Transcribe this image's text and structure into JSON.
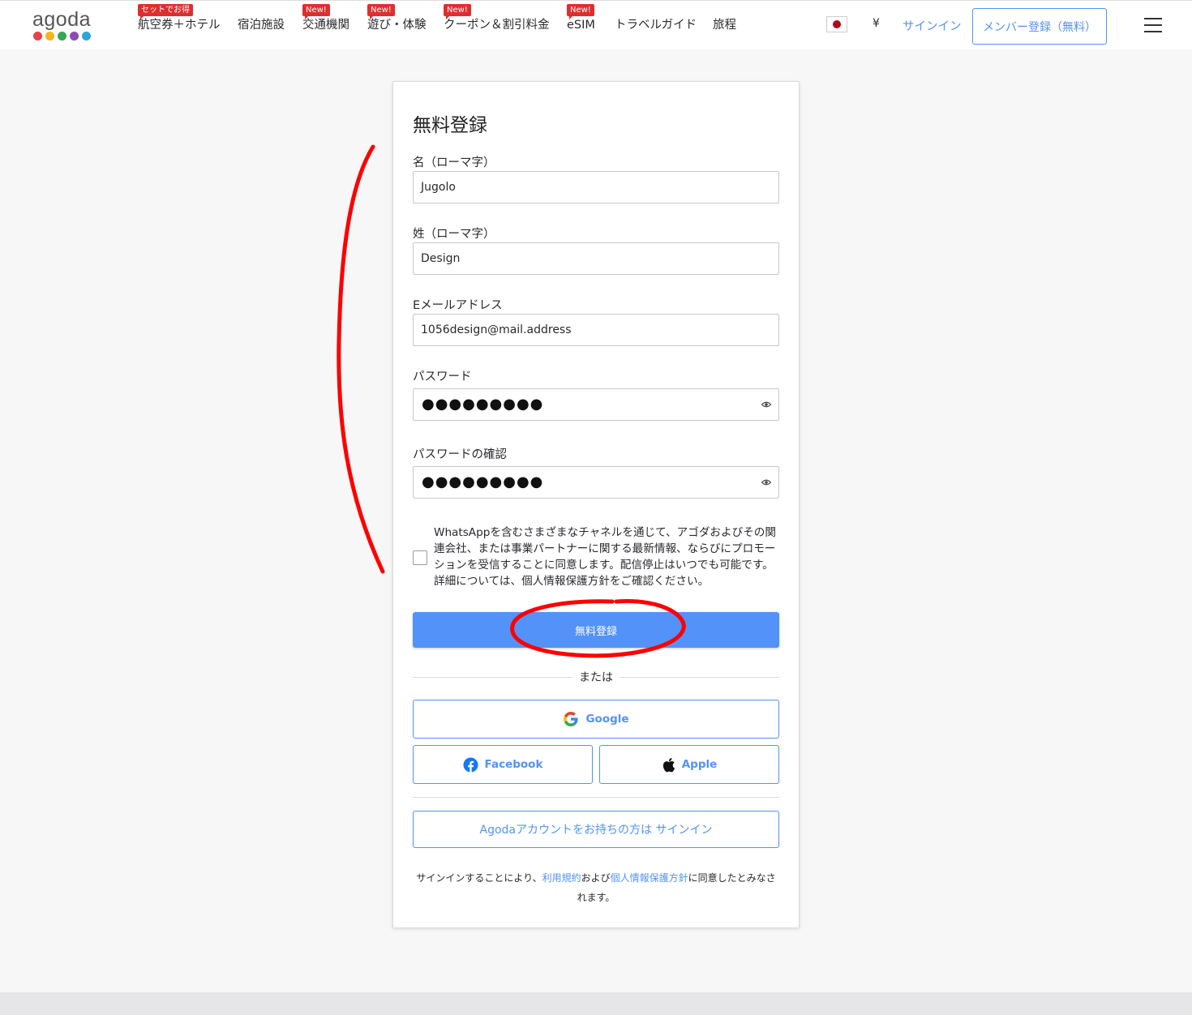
{
  "header": {
    "logo_text": "agoda",
    "logo_colors": [
      "#e8424b",
      "#f8b41b",
      "#32a852",
      "#8d4bb4",
      "#2aa6dc"
    ],
    "nav": [
      {
        "label": "航空券＋ホテル",
        "badge": "セットでお得"
      },
      {
        "label": "宿泊施設",
        "badge": ""
      },
      {
        "label": "交通機関",
        "badge": "New!"
      },
      {
        "label": "遊び・体験",
        "badge": "New!"
      },
      {
        "label": "クーポン＆割引料金",
        "badge": "New!"
      },
      {
        "label": "eSIM",
        "badge": "New!"
      },
      {
        "label": "トラベルガイド",
        "badge": ""
      },
      {
        "label": "旅程",
        "badge": ""
      }
    ],
    "currency": "¥",
    "signin": "サインイン",
    "register": "メンバー登録（無料）"
  },
  "form": {
    "title": "無料登録",
    "first_name_label": "名（ローマ字）",
    "first_name_value": "Jugolo",
    "last_name_label": "姓（ローマ字）",
    "last_name_value": "Design",
    "email_label": "Eメールアドレス",
    "email_value": "1056design@mail.address",
    "password_label": "パスワード",
    "password_mask": "●●●●●●●●●",
    "password_confirm_label": "パスワードの確認",
    "password_confirm_mask": "●●●●●●●●●",
    "consent_text": "WhatsAppを含むさまざまなチャネルを通じて、アゴダおよびその関連会社、または事業パートナーに関する最新情報、ならびにプロモーションを受信することに同意します。配信停止はいつでも可能です。詳細については、個人情報保護方針をご確認ください。",
    "submit": "無料登録",
    "or": "または",
    "google": "Google",
    "facebook": "Facebook",
    "apple": "Apple",
    "existing_account": "Agodaアカウントをお持ちの方は サインイン",
    "terms_prefix": "サインインすることにより、",
    "terms_link": "利用規約",
    "terms_middle": "および",
    "privacy_link": "個人情報保護方針",
    "terms_suffix": "に同意したとみなされます。"
  },
  "colors": {
    "accent": "#5392f9",
    "badge": "#e12d2d",
    "annotation": "#ff0000"
  }
}
